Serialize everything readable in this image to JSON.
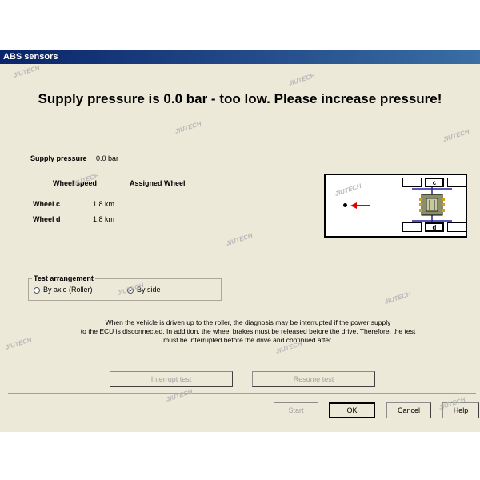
{
  "window": {
    "title": "ABS sensors"
  },
  "headline": "Supply pressure is  0.0 bar - too low. Please increase pressure!",
  "supply": {
    "label": "Supply pressure",
    "value": "0.0 bar"
  },
  "table": {
    "col_wheel_speed": "Wheel speed",
    "col_assigned": "Assigned Wheel",
    "rows": [
      {
        "wheel": "Wheel c",
        "speed": "1.8 km"
      },
      {
        "wheel": "Wheel d",
        "speed": "1.8 km"
      }
    ]
  },
  "diagram": {
    "top_label": "c",
    "bottom_label": "d",
    "arrow_color": "#e00000"
  },
  "test_arrangement": {
    "title": "Test arrangement",
    "options": [
      {
        "label": "By axle (Roller)",
        "selected": false
      },
      {
        "label": "By side",
        "selected": true
      }
    ]
  },
  "info_lines": [
    "When the vehicle is driven up to the roller, the diagnosis may be interrupted if the power supply",
    "to the ECU is disconnected. In addition, the wheel brakes must be released before the drive. Therefore, the test",
    "must be interrupted before the drive and continued after."
  ],
  "buttons": {
    "interrupt": "Interrupt test",
    "resume": "Resume test",
    "start": "Start",
    "ok": "OK",
    "cancel": "Cancel",
    "help": "Help"
  },
  "watermark": "JIUTECH"
}
